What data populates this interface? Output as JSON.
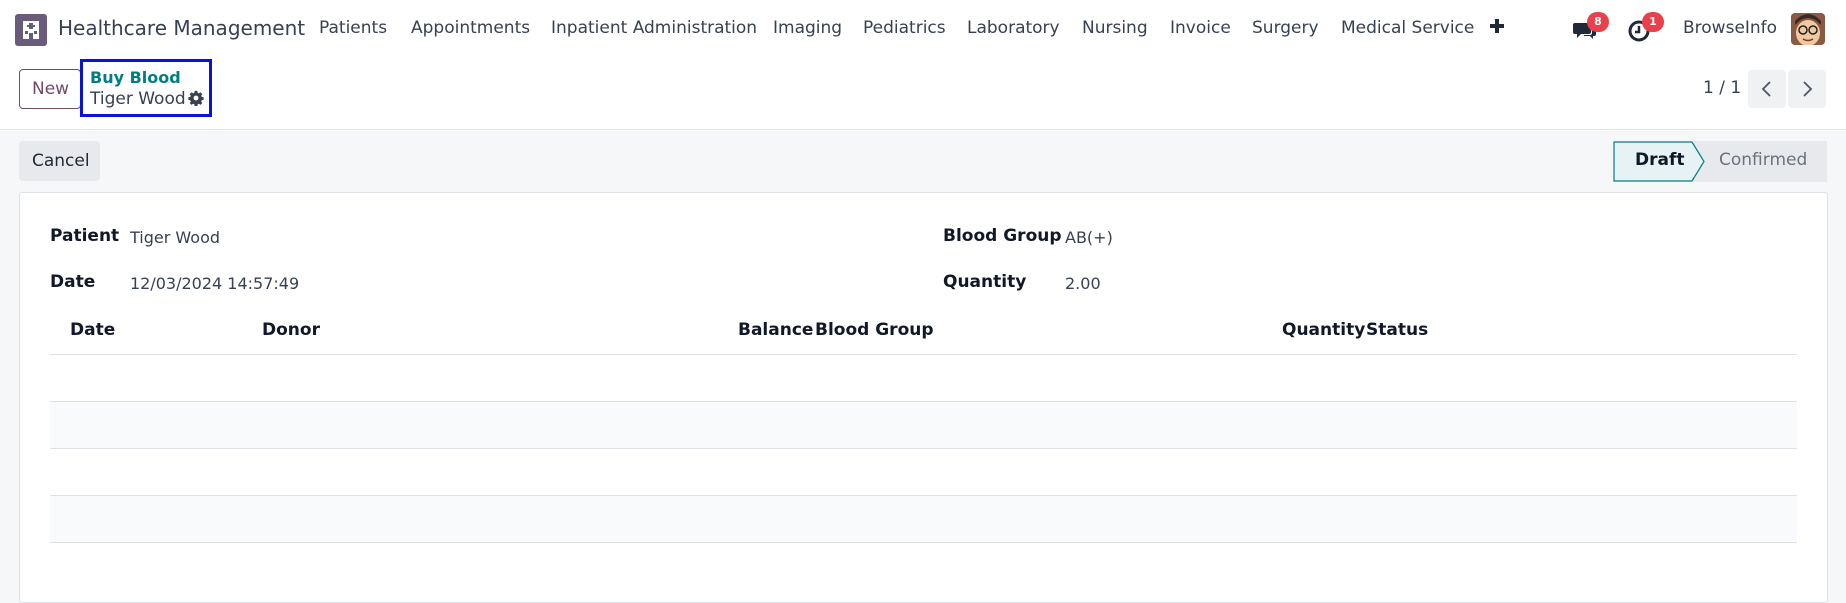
{
  "app": {
    "name": "Healthcare Management",
    "icon": "hospital-building-icon"
  },
  "menu": {
    "items": [
      {
        "label": "Patients"
      },
      {
        "label": "Appointments"
      },
      {
        "label": "Inpatient Administration"
      },
      {
        "label": "Imaging"
      },
      {
        "label": "Pediatrics"
      },
      {
        "label": "Laboratory"
      },
      {
        "label": "Nursing"
      },
      {
        "label": "Invoice"
      },
      {
        "label": "Surgery"
      },
      {
        "label": "Medical Service"
      }
    ]
  },
  "systray": {
    "messages_count": "8",
    "activities_count": "1",
    "company": "BrowseInfo"
  },
  "control": {
    "new_label": "New",
    "breadcrumb_parent": "Buy Blood",
    "breadcrumb_current": "Tiger Wood",
    "pager": "1 / 1"
  },
  "form": {
    "cancel_label": "Cancel",
    "status": {
      "draft": "Draft",
      "confirmed": "Confirmed",
      "active": "Draft"
    },
    "fields": {
      "patient_label": "Patient",
      "patient_value": "Tiger Wood",
      "date_label": "Date",
      "date_value": "12/03/2024 14:57:49",
      "blood_group_label": "Blood Group",
      "blood_group_value": "AB(+)",
      "quantity_label": "Quantity",
      "quantity_value": "2.00"
    },
    "table": {
      "columns": [
        "Date",
        "Donor",
        "Balance",
        "Blood Group",
        "Quantity",
        "Status"
      ],
      "rows": []
    }
  },
  "colors": {
    "brand": "#714b67",
    "link": "#017e84",
    "badge": "#e8414b",
    "highlight_box": "#0a12d6",
    "status_active_bg": "#e6f2f3"
  }
}
